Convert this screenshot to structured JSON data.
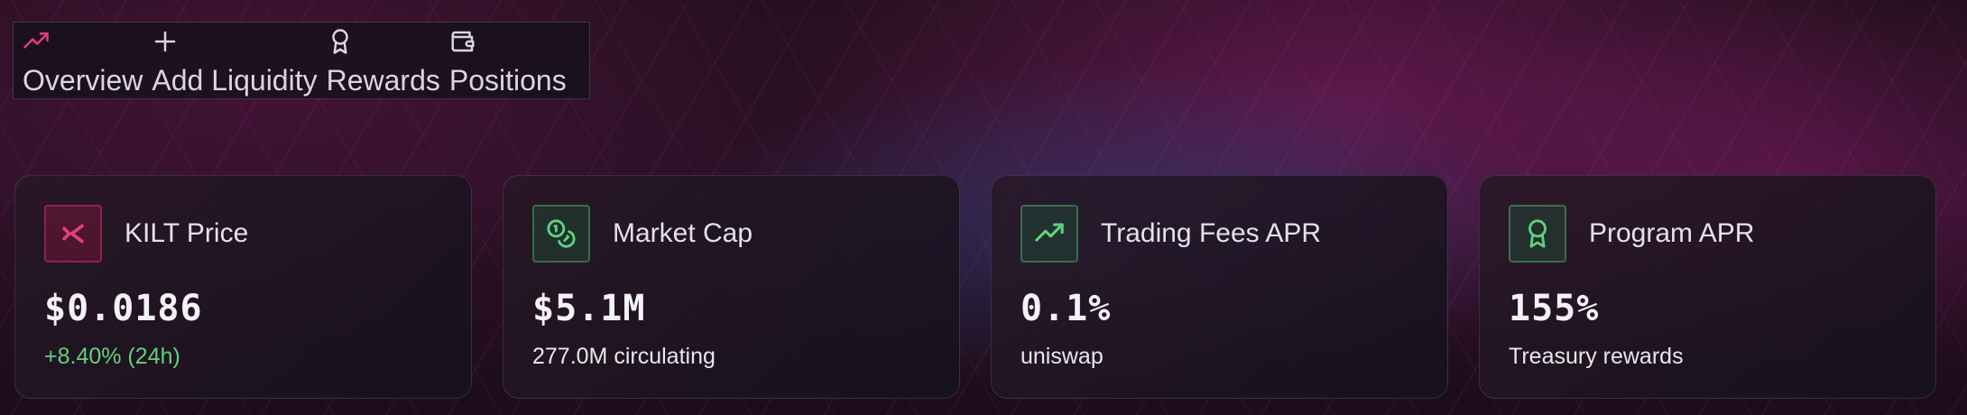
{
  "nav": {
    "items": [
      {
        "label": "Overview",
        "icon": "trending-up-icon"
      },
      {
        "label": "Add Liquidity",
        "icon": "plus-icon"
      },
      {
        "label": "Rewards",
        "icon": "award-icon"
      },
      {
        "label": "Positions",
        "icon": "wallet-icon"
      }
    ]
  },
  "cards": [
    {
      "title": "KILT Price",
      "value": "$0.0186",
      "sub": "+8.40% (24h)",
      "icon": "kilt-logo-icon"
    },
    {
      "title": "Market Cap",
      "value": "$5.1M",
      "sub": "277.0M circulating",
      "icon": "coins-icon"
    },
    {
      "title": "Trading Fees APR",
      "value": "0.1%",
      "sub": "uniswap",
      "icon": "trending-up-icon"
    },
    {
      "title": "Program APR",
      "value": "155%",
      "sub": "Treasury rewards",
      "icon": "award-icon"
    }
  ],
  "colors": {
    "accent_pink": "#e0407a",
    "accent_green": "#5ed27e",
    "positive": "#5ed27e"
  }
}
